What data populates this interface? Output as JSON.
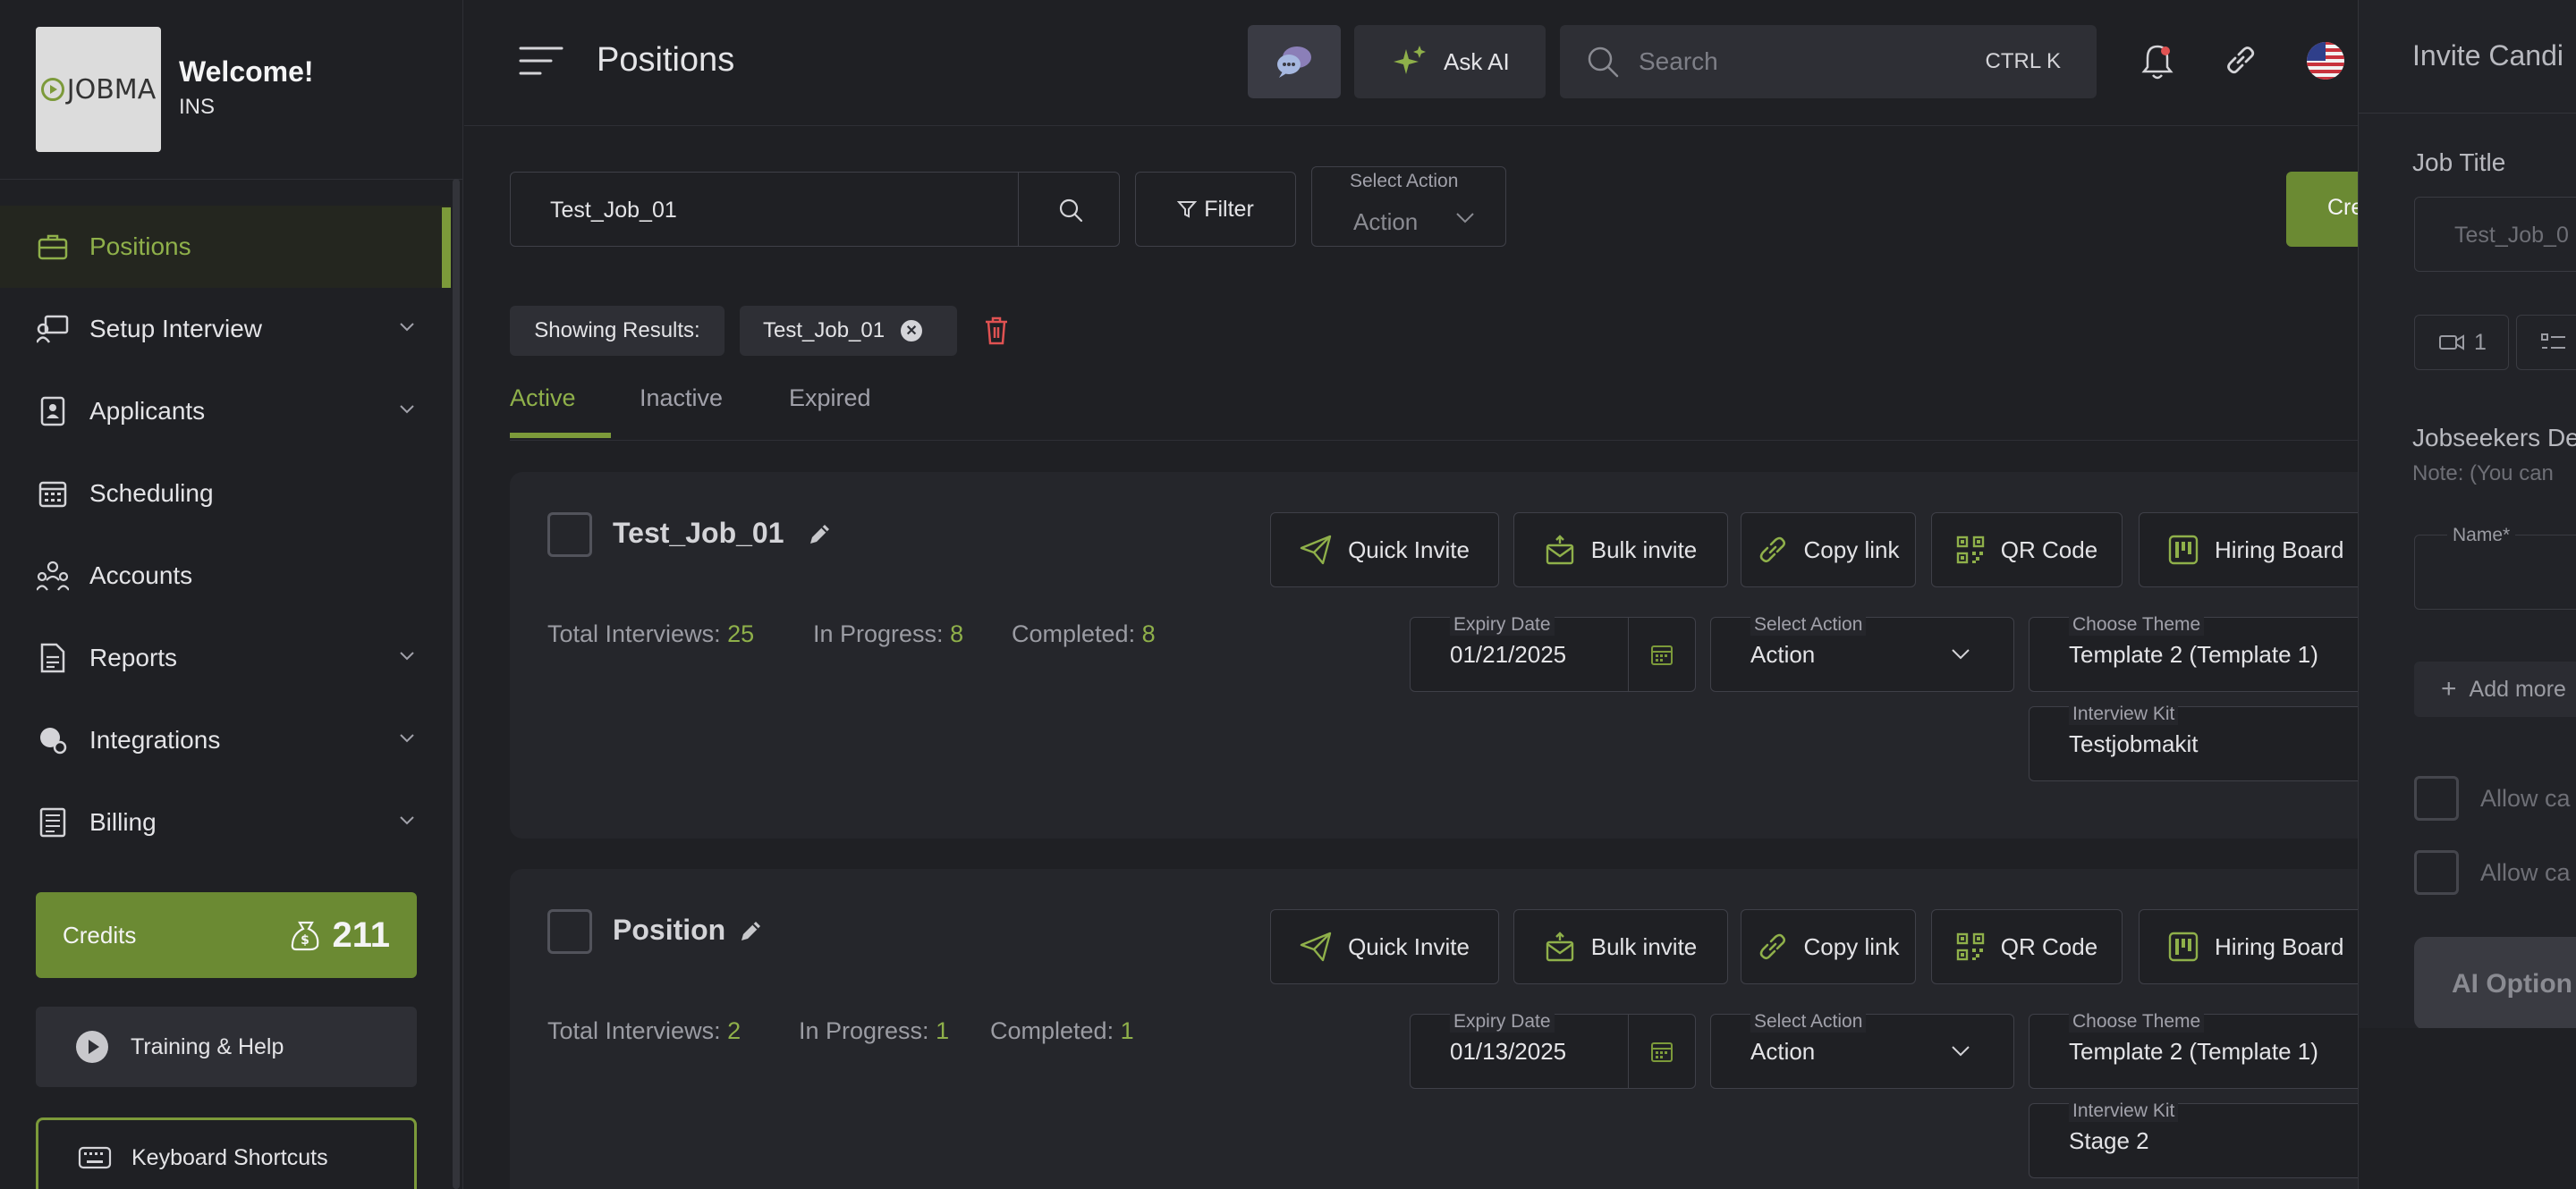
{
  "sidebar": {
    "welcome": "Welcome!",
    "org": "INS",
    "logo_text": "JOBMA",
    "items": [
      {
        "label": "Positions",
        "icon": "briefcase-icon"
      },
      {
        "label": "Setup Interview",
        "icon": "interview-icon"
      },
      {
        "label": "Applicants",
        "icon": "applicant-icon"
      },
      {
        "label": "Scheduling",
        "icon": "calendar-icon"
      },
      {
        "label": "Accounts",
        "icon": "users-icon"
      },
      {
        "label": "Reports",
        "icon": "report-icon"
      },
      {
        "label": "Integrations",
        "icon": "integrations-icon"
      },
      {
        "label": "Billing",
        "icon": "billing-icon"
      }
    ],
    "credits_label": "Credits",
    "credits_value": "211",
    "training_label": "Training & Help",
    "shortcuts_label": "Keyboard Shortcuts"
  },
  "header": {
    "title": "Positions",
    "ask_ai": "Ask AI",
    "search_placeholder": "Search",
    "search_shortcut": "CTRL K"
  },
  "toolbar": {
    "search_value": "Test_Job_01",
    "filter_label": "Filter",
    "select_action_label": "Select Action",
    "select_action_value": "Action",
    "create_label": "Cre"
  },
  "results": {
    "showing_label": "Showing Results:",
    "chip_value": "Test_Job_01"
  },
  "tabs": [
    "Active",
    "Inactive",
    "Expired"
  ],
  "actions": {
    "quick_invite": "Quick Invite",
    "bulk_invite": "Bulk invite",
    "copy_link": "Copy link",
    "qr_code": "QR Code",
    "hiring_board": "Hiring Board"
  },
  "labels": {
    "total_interviews": "Total Interviews:",
    "in_progress": "In Progress:",
    "completed": "Completed:",
    "expiry_date": "Expiry Date",
    "select_action": "Select Action",
    "choose_theme": "Choose Theme",
    "interview_kit": "Interview Kit",
    "action": "Action"
  },
  "positions": [
    {
      "title": "Test_Job_01",
      "total": "25",
      "in_progress": "8",
      "completed": "8",
      "expiry": "01/21/2025",
      "theme": "Template 2 (Template 1)",
      "kit": "Testjobmakit"
    },
    {
      "title": "Position",
      "total": "2",
      "in_progress": "1",
      "completed": "1",
      "expiry": "01/13/2025",
      "theme": "Template 2 (Template 1)",
      "kit": "Stage 2"
    }
  ],
  "panel": {
    "title": "Invite Candi",
    "job_title_label": "Job Title",
    "job_title_value": "Test_Job_0",
    "video_count": "1",
    "jobseekers_label": "Jobseekers De",
    "note": "Note: (You can",
    "name_label": "Name*",
    "add_more": "Add more",
    "allow_1": "Allow ca",
    "allow_2": "Allow ca",
    "ai_options": "AI Option"
  },
  "colors": {
    "accent": "#7c9a3a",
    "accent_text": "#8fb04a",
    "background": "#1f2024",
    "card": "#25262b",
    "danger": "#e05252"
  }
}
